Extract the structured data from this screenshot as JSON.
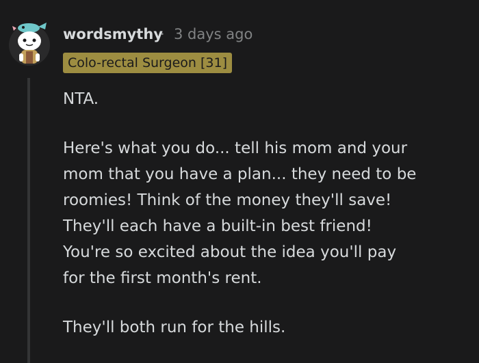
{
  "comment": {
    "username": "wordsmythy",
    "separator": "·",
    "timestamp": "3 days ago",
    "flair": "Colo-rectal Surgeon [31]",
    "flair_color": "#9d8d41",
    "avatar_icon": "snoo-avatar-icon",
    "paragraphs": [
      "NTA.",
      "Here's what you do... tell his mom and your\nmom that you have a plan... they need to be\nroomies! Think of the money they'll save!\nThey'll each have a built-in best friend!\nYou're so excited about the idea you'll pay\nfor the first month's rent.",
      "They'll both run for the hills."
    ]
  }
}
